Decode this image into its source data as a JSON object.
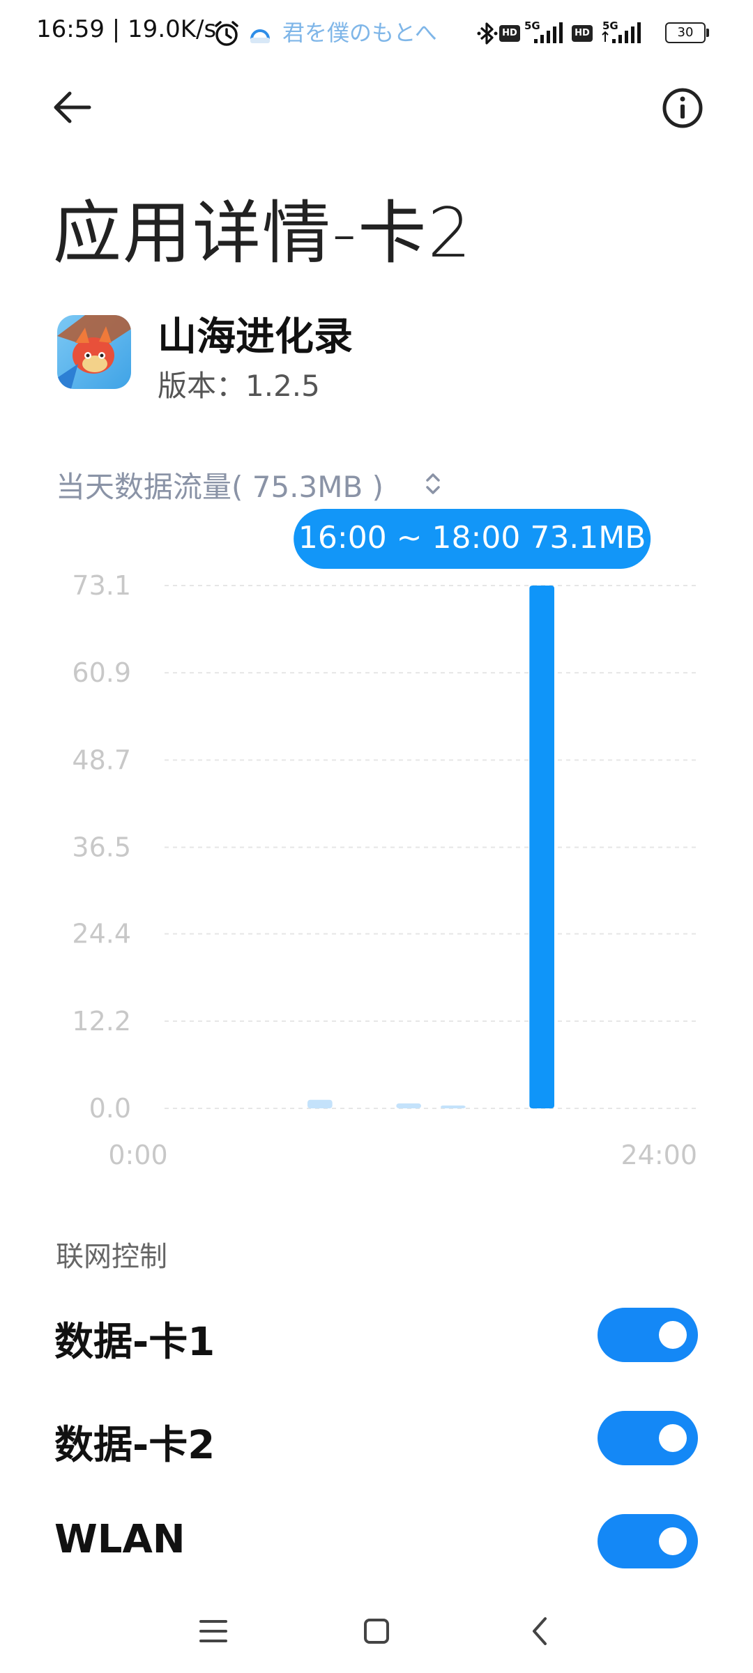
{
  "status_bar": {
    "time_speed": "16:59 | 19.0K/s",
    "song": "君を僕のもとへ",
    "network_1": "5G",
    "network_2": "5G",
    "hd_label": "HD",
    "battery": "30"
  },
  "header": {
    "title": "应用详情-卡2",
    "back_icon": "arrow-left-icon",
    "info_icon": "info-circle-icon"
  },
  "app": {
    "name": "山海进化录",
    "version": "版本：1.2.5",
    "icon": "app-icon"
  },
  "usage": {
    "label": "当天数据流量( 75.3MB )"
  },
  "chart_data": {
    "type": "bar",
    "unit": "MB",
    "tooltip": "16:00 ~ 18:00 73.1MB",
    "y_ticks": [
      "73.1",
      "60.9",
      "48.7",
      "36.5",
      "24.4",
      "12.2",
      "0.0"
    ],
    "ylim": [
      0,
      73.1
    ],
    "x_tick_labels": [
      "0:00",
      "24:00"
    ],
    "x_range_hours": [
      0,
      24
    ],
    "bars": [
      {
        "start_hour": 6,
        "end_hour": 8,
        "value": 1.2,
        "highlighted": false
      },
      {
        "start_hour": 10,
        "end_hour": 12,
        "value": 0.7,
        "highlighted": false
      },
      {
        "start_hour": 12,
        "end_hour": 14,
        "value": 0.4,
        "highlighted": false
      },
      {
        "start_hour": 16,
        "end_hour": 18,
        "value": 73.1,
        "highlighted": true
      }
    ],
    "colors": {
      "highlight": "#0f95f9",
      "dim": "#c4e2fb",
      "tooltip": "#1296f8"
    }
  },
  "network_control": {
    "section_label": "联网控制",
    "rows": [
      {
        "label": "数据-卡1",
        "enabled": true
      },
      {
        "label": "数据-卡2",
        "enabled": true
      },
      {
        "label": "WLAN",
        "enabled": true
      }
    ]
  },
  "nav_bar": {
    "menu_icon": "menu-icon",
    "home_icon": "home-square-icon",
    "back_icon": "back-chevron-icon"
  }
}
